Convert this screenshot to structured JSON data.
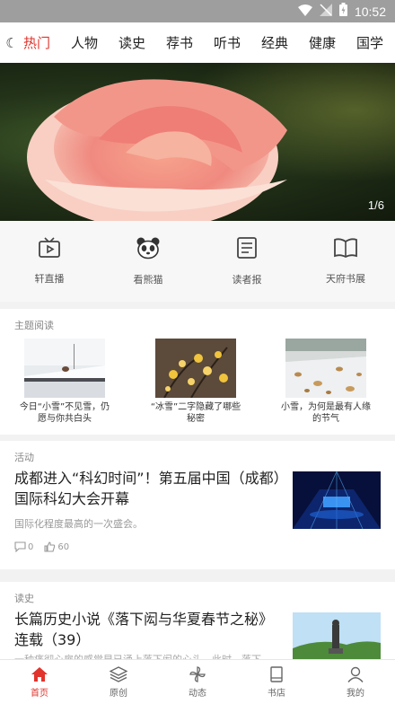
{
  "status_bar": {
    "time": "10:52"
  },
  "tabs": {
    "moon_glyph": "☾",
    "items": [
      "热门",
      "人物",
      "读史",
      "荐书",
      "听书",
      "经典",
      "健康",
      "国学"
    ],
    "active_index": 0
  },
  "banner": {
    "counter": "1/6"
  },
  "quick_links": [
    {
      "label": "轩直播",
      "icon": "live-tv-icon"
    },
    {
      "label": "看熊猫",
      "icon": "panda-icon"
    },
    {
      "label": "读者报",
      "icon": "newspaper-icon"
    },
    {
      "label": "天府书展",
      "icon": "open-book-icon"
    }
  ],
  "topics": {
    "title": "主题阅读",
    "items": [
      {
        "caption_line1": "今日“小雪”不见雪，仍",
        "caption_line2": "愿与你共白头"
      },
      {
        "caption_line1": "“冰雪”二字隐藏了哪些",
        "caption_line2": "秘密"
      },
      {
        "caption_line1": "小雪，为何是最有人缘",
        "caption_line2": "的节气"
      }
    ]
  },
  "activity": {
    "section": "活动",
    "title": "成都进入“科幻时间”！第五届中国（成都）国际科幻大会开幕",
    "subtitle": "国际化程度最高的一次盛会。",
    "comments": "0",
    "likes": "60"
  },
  "history": {
    "section": "读史",
    "title": "长篇历史小说《落下闳与华夏春节之秘》连载（39）",
    "subtitle": "一种痛彻心扉的感觉早已涌上落下闳的心头。此时，落下"
  },
  "bottom_nav": {
    "items": [
      "首页",
      "原创",
      "动态",
      "书店",
      "我的"
    ],
    "active_index": 0
  },
  "colors": {
    "accent": "#e0342c"
  }
}
